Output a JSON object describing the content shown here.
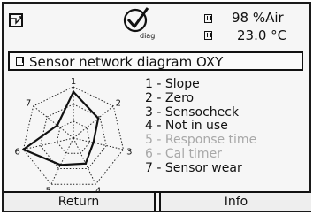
{
  "status": {
    "mode_icon": "measurement-mode-icon",
    "diag_icon": "checkmark-circle-icon",
    "diag_label": "diag",
    "readings": [
      {
        "value": "98 %Air"
      },
      {
        "value": "23.0 °C"
      }
    ]
  },
  "title": "Sensor network diagram  OXY",
  "radar": {
    "axis_labels": [
      "1",
      "2",
      "3",
      "4",
      "5",
      "6",
      "7"
    ],
    "values": [
      0.9,
      0.62,
      0.4,
      0.55,
      0.58,
      1.0,
      0.4
    ]
  },
  "legend": [
    {
      "label": "1 - Slope",
      "active": true
    },
    {
      "label": "2 - Zero",
      "active": true
    },
    {
      "label": "3 - Sensocheck",
      "active": true
    },
    {
      "label": "4 - Not in use",
      "active": true
    },
    {
      "label": "5 - Response time",
      "active": false
    },
    {
      "label": "6 - Cal timer",
      "active": false
    },
    {
      "label": "7 - Sensor wear",
      "active": true
    }
  ],
  "softkeys": {
    "left": "Return",
    "right": "Info"
  },
  "colors": {
    "frame": "#111111",
    "background": "#f6f6f6",
    "inactive_text": "#a8a8a8"
  }
}
